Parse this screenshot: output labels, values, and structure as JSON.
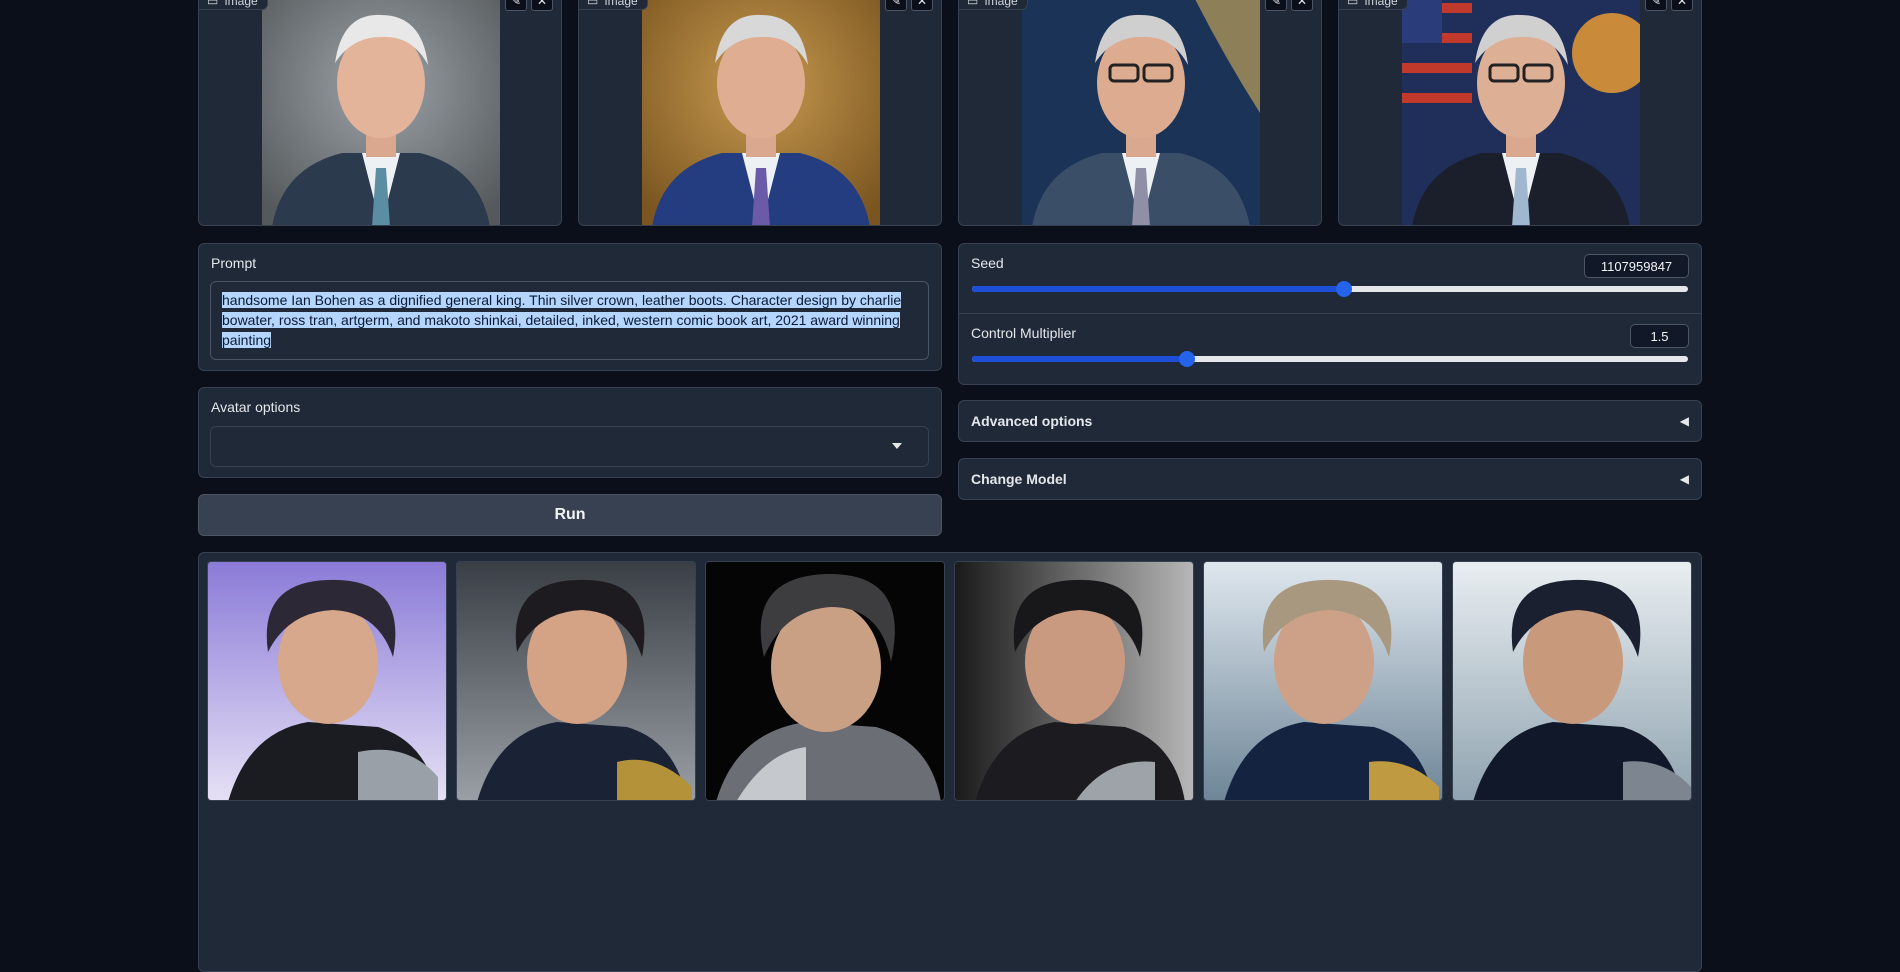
{
  "uploads": [
    {
      "tag": "Image",
      "edit_icon": "pencil-icon",
      "clear_icon": "close-icon"
    },
    {
      "tag": "Image",
      "edit_icon": "pencil-icon",
      "clear_icon": "close-icon"
    },
    {
      "tag": "Image",
      "edit_icon": "pencil-icon",
      "clear_icon": "close-icon"
    },
    {
      "tag": "Image",
      "edit_icon": "pencil-icon",
      "clear_icon": "close-icon"
    }
  ],
  "prompt": {
    "label": "Prompt",
    "value": "handsome Ian Bohen as a dignified general king. Thin silver crown, leather boots. Character design by charlie bowater, ross tran, artgerm, and makoto shinkai, detailed, inked, western comic book art, 2021 award winning painting"
  },
  "avatar_options": {
    "label": "Avatar options",
    "value": ""
  },
  "run_button": "Run",
  "seed": {
    "label": "Seed",
    "value": "1107959847",
    "level": 0.52
  },
  "control_multiplier": {
    "label": "Control Multiplier",
    "value": "1.5",
    "level": 0.3
  },
  "advanced_options": {
    "label": "Advanced options",
    "icon": "triangle-left-icon"
  },
  "change_model": {
    "label": "Change Model",
    "icon": "triangle-left-icon"
  },
  "colors": {
    "accent": "#2563eb",
    "background": "#0b0f19",
    "panel": "#1f2937",
    "border": "#374151"
  }
}
